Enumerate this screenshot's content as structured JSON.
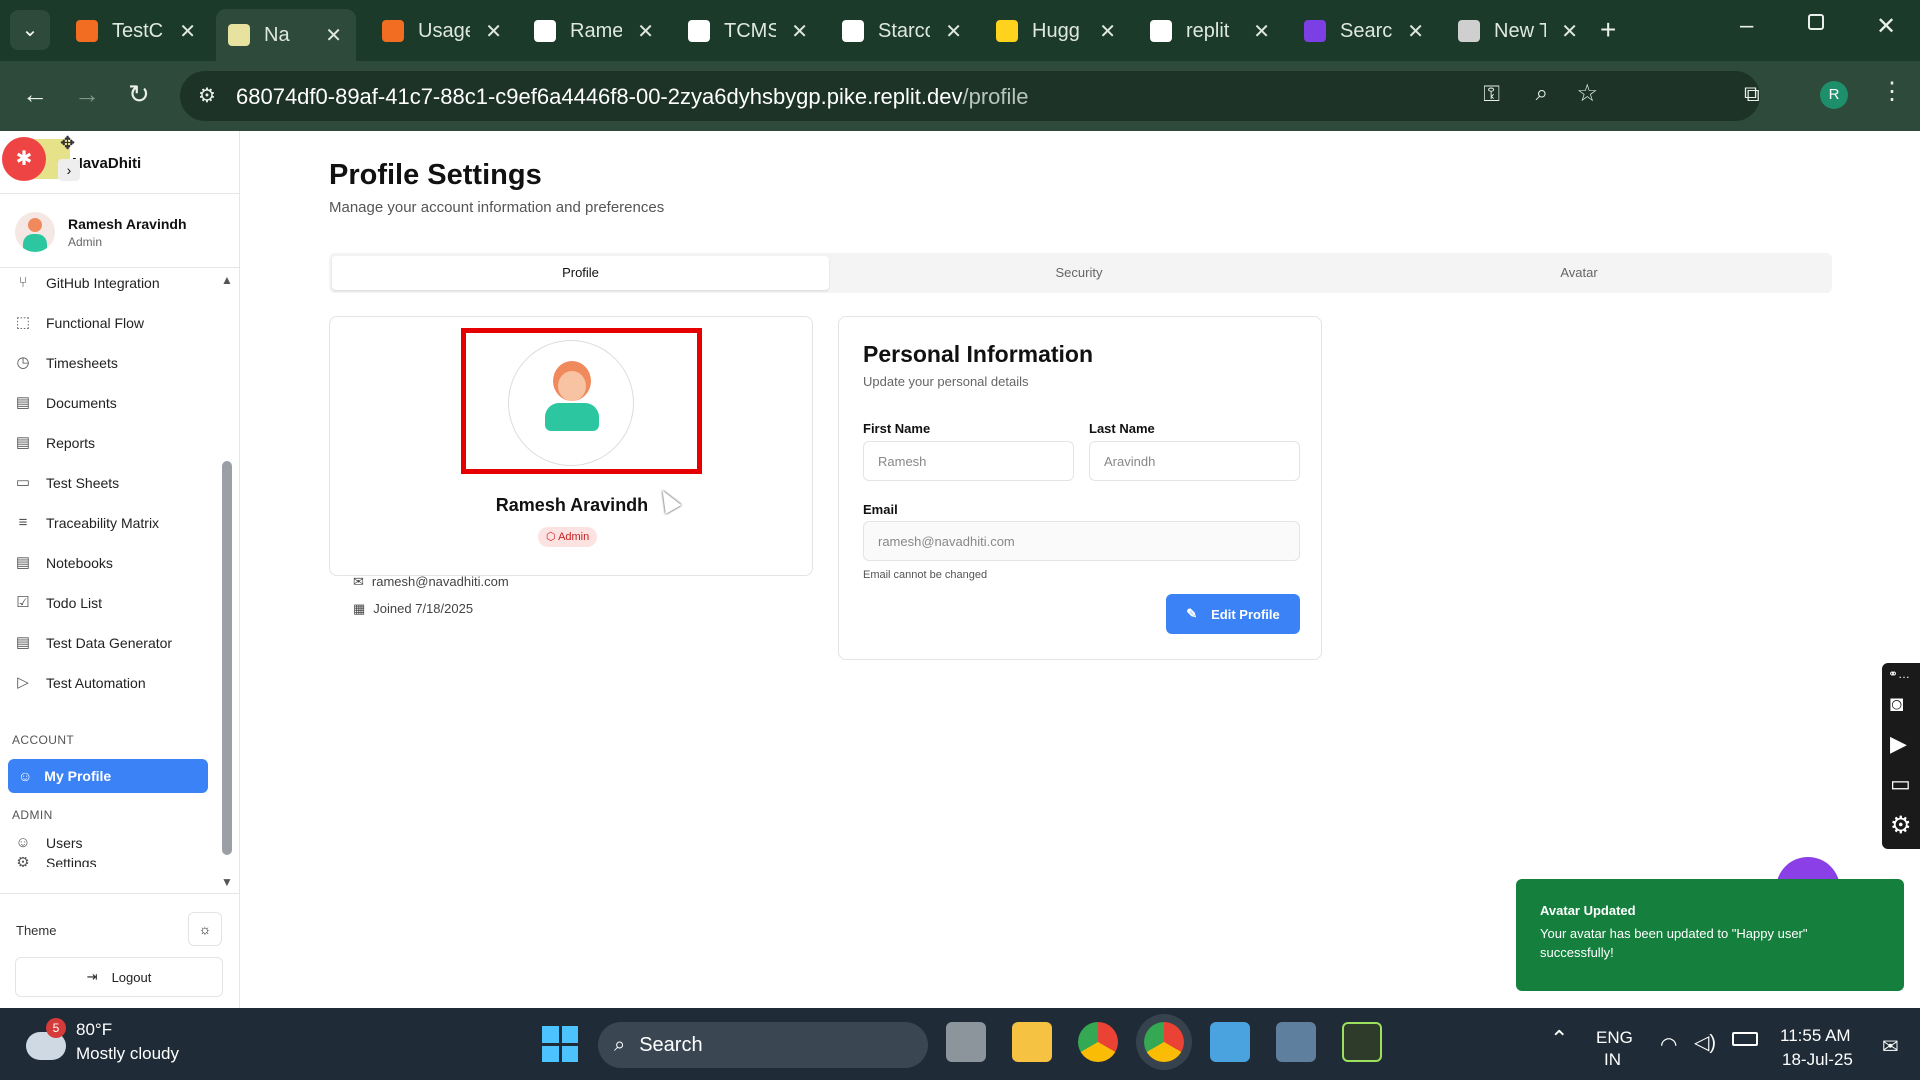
{
  "browser": {
    "tabs": [
      {
        "label": "TestCa",
        "color": "#f26d21"
      },
      {
        "label": "Na",
        "color": "#e8e2a0"
      },
      {
        "label": "Usage",
        "color": "#f26d21"
      },
      {
        "label": "Rame",
        "color": "#ffffff"
      },
      {
        "label": "TCMS",
        "color": "#ffffff"
      },
      {
        "label": "Starco",
        "color": "#ffffff"
      },
      {
        "label": "Hugg",
        "color": "#ffd21e"
      },
      {
        "label": "replit",
        "color": "#ffffff"
      },
      {
        "label": "Searc",
        "color": "#7b3fe4"
      },
      {
        "label": "New T",
        "color": "#cfcfcf"
      }
    ],
    "url_host": "68074df0-89af-41c7-88c1-c9ef6a4446f8-00-2zya6dyhsbygp.pike.replit.dev",
    "url_path": "/profile",
    "profile_initial": "R"
  },
  "sidebar": {
    "brand": "NavaDhiti",
    "user_name": "Ramesh Aravindh",
    "user_role": "Admin",
    "items": [
      {
        "label": "GitHub Integration",
        "icon": "⑂"
      },
      {
        "label": "Functional Flow",
        "icon": "⬚"
      },
      {
        "label": "Timesheets",
        "icon": "◷"
      },
      {
        "label": "Documents",
        "icon": "▤"
      },
      {
        "label": "Reports",
        "icon": "▤"
      },
      {
        "label": "Test Sheets",
        "icon": "▭"
      },
      {
        "label": "Traceability Matrix",
        "icon": "≡"
      },
      {
        "label": "Notebooks",
        "icon": "▤"
      },
      {
        "label": "Todo List",
        "icon": "☑"
      },
      {
        "label": "Test Data Generator",
        "icon": "▤"
      },
      {
        "label": "Test Automation",
        "icon": "▷"
      }
    ],
    "section_account": "ACCOUNT",
    "my_profile": "My Profile",
    "section_admin": "ADMIN",
    "users": "Users",
    "settings": "Settings",
    "theme": "Theme",
    "logout": "Logout"
  },
  "main": {
    "title": "Profile Settings",
    "subtitle": "Manage your account information and preferences",
    "tabs": [
      "Profile",
      "Security",
      "Avatar"
    ],
    "profile_card": {
      "name": "Ramesh Aravindh",
      "role": "Admin",
      "email": "ramesh@navadhiti.com",
      "joined": "Joined 7/18/2025"
    },
    "personal": {
      "title": "Personal Information",
      "subtitle": "Update your personal details",
      "first_label": "First Name",
      "first_value": "Ramesh",
      "last_label": "Last Name",
      "last_value": "Aravindh",
      "email_label": "Email",
      "email_value": "ramesh@navadhiti.com",
      "email_note": "Email cannot be changed",
      "edit_button": "Edit Profile"
    }
  },
  "toast": {
    "title": "Avatar Updated",
    "message": "Your avatar has been updated to \"Happy user\" successfully!",
    "color": "#15803d"
  },
  "taskbar": {
    "weather_badge": "5",
    "temp": "80°F",
    "weather": "Mostly cloudy",
    "search": "Search",
    "lang1": "ENG",
    "lang2": "IN",
    "time": "11:55 AM",
    "date": "18-Jul-25"
  }
}
